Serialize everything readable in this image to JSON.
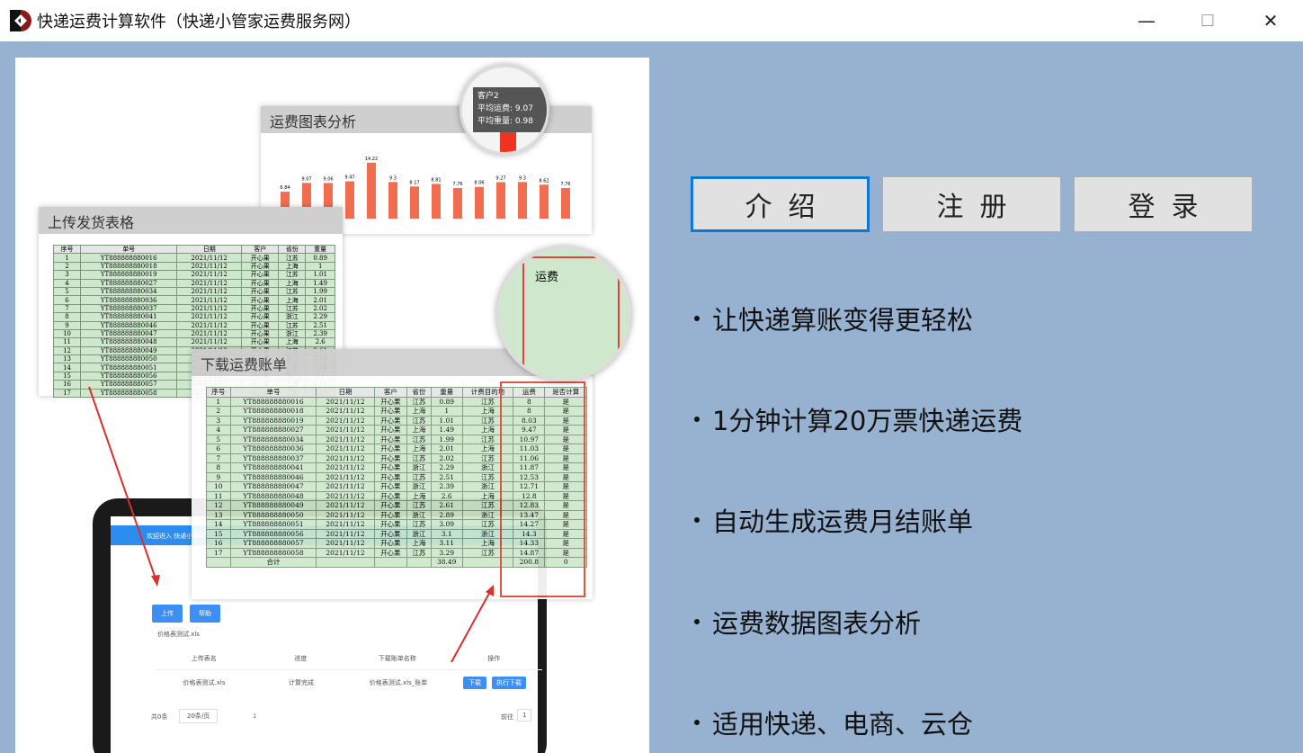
{
  "window": {
    "title": "快递运费计算软件（快递小管家运费服务网）",
    "minimize": "—",
    "maximize": "☐",
    "close": "✕"
  },
  "nav": {
    "intro": "介绍",
    "register": "注册",
    "login": "登录"
  },
  "features": [
    "让快递算账变得更轻松",
    "1分钟计算20万票快递运费",
    "自动生成运费月结账单",
    "运费数据图表分析",
    "适用快递、电商、云仓"
  ],
  "illustration": {
    "chart_title": "运费图表分析",
    "chart_values": [
      6.84,
      9.07,
      9.06,
      9.47,
      14.22,
      9.3,
      8.17,
      8.81,
      7.76,
      8.06,
      9.27,
      9.3,
      8.62,
      7.76
    ],
    "tooltip": {
      "title": "客户2",
      "line1": "平均运费: 9.07",
      "line2": "平均重量: 0.98"
    },
    "upload_title": "上传发货表格",
    "upload_headers": [
      "序号",
      "单号",
      "日期",
      "客户",
      "省份",
      "重量"
    ],
    "download_title": "下载运费账单",
    "download_headers": [
      "序号",
      "单号",
      "日期",
      "客户",
      "省份",
      "重量",
      "计费目的地",
      "运费",
      "是否计算"
    ],
    "rows": [
      [
        "1",
        "YT888888880016",
        "2021/11/12",
        "开心果",
        "江苏",
        "0.89",
        "江苏",
        "8",
        "是"
      ],
      [
        "2",
        "YT888888880018",
        "2021/11/12",
        "开心果",
        "上海",
        "1",
        "上海",
        "8",
        "是"
      ],
      [
        "3",
        "YT888888880019",
        "2021/11/12",
        "开心果",
        "江苏",
        "1.01",
        "江苏",
        "8.03",
        "是"
      ],
      [
        "4",
        "YT888888880027",
        "2021/11/12",
        "开心果",
        "上海",
        "1.49",
        "上海",
        "9.47",
        "是"
      ],
      [
        "5",
        "YT888888880034",
        "2021/11/12",
        "开心果",
        "江苏",
        "1.99",
        "江苏",
        "10.97",
        "是"
      ],
      [
        "6",
        "YT888888880036",
        "2021/11/12",
        "开心果",
        "上海",
        "2.01",
        "上海",
        "11.03",
        "是"
      ],
      [
        "7",
        "YT888888880037",
        "2021/11/12",
        "开心果",
        "江苏",
        "2.02",
        "江苏",
        "11.06",
        "是"
      ],
      [
        "8",
        "YT888888880041",
        "2021/11/12",
        "开心果",
        "浙江",
        "2.29",
        "浙江",
        "11.87",
        "是"
      ],
      [
        "9",
        "YT888888880046",
        "2021/11/12",
        "开心果",
        "江苏",
        "2.51",
        "江苏",
        "12.53",
        "是"
      ],
      [
        "10",
        "YT888888880047",
        "2021/11/12",
        "开心果",
        "浙江",
        "2.39",
        "浙江",
        "12.71",
        "是"
      ],
      [
        "11",
        "YT888888880048",
        "2021/11/12",
        "开心果",
        "上海",
        "2.6",
        "上海",
        "12.8",
        "是"
      ],
      [
        "12",
        "YT888888880049",
        "2021/11/12",
        "开心果",
        "江苏",
        "2.61",
        "江苏",
        "12.83",
        "是"
      ],
      [
        "13",
        "YT888888880050",
        "2021/11/12",
        "开心果",
        "浙江",
        "2.89",
        "浙江",
        "13.47",
        "是"
      ],
      [
        "14",
        "YT888888880051",
        "2021/11/12",
        "开心果",
        "江苏",
        "3.09",
        "江苏",
        "14.27",
        "是"
      ],
      [
        "15",
        "YT888888880056",
        "2021/11/12",
        "开心果",
        "浙江",
        "3.1",
        "浙江",
        "14.3",
        "是"
      ],
      [
        "16",
        "YT888888880057",
        "2021/11/12",
        "开心果",
        "上海",
        "3.11",
        "上海",
        "14.33",
        "是"
      ],
      [
        "17",
        "YT888888880058",
        "2021/11/12",
        "开心果",
        "江苏",
        "3.29",
        "江苏",
        "14.87",
        "是"
      ]
    ],
    "total_row": [
      "",
      "合计",
      "",
      "",
      "",
      "38.49",
      "",
      "200.8",
      "0"
    ],
    "app": {
      "header": "欢迎进入 快递小管家",
      "upload": "上传",
      "help": "帮助",
      "file": "价格表测试.xls",
      "headers": [
        "上传表名",
        "进度",
        "下载账单名称",
        "操作"
      ],
      "row": [
        "价格表测试.xls",
        "计算完成",
        "价格表测试.xls_账单"
      ],
      "download": "下载",
      "exec_download": "执行下载",
      "total": "共0条",
      "page_size": "20条/页",
      "page": "1",
      "goto": "前往",
      "goto_value": "1"
    }
  }
}
